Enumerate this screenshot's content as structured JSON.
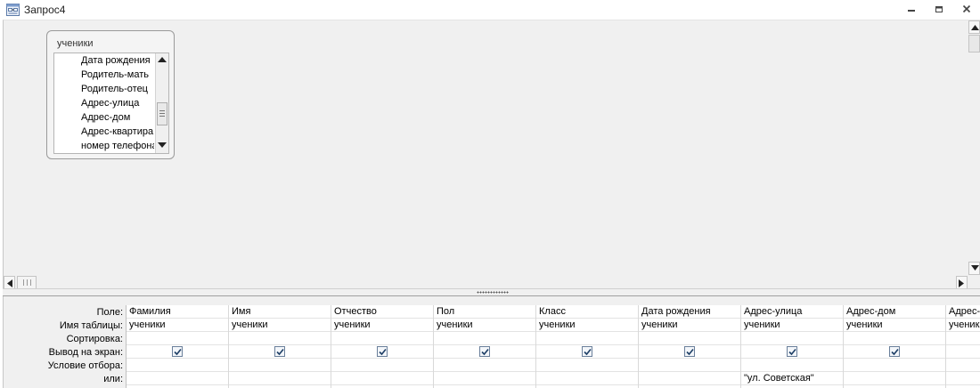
{
  "window": {
    "title": "Запрос4",
    "controls": {
      "minimize": "minimize-icon",
      "restore": "restore-icon",
      "close": "close-icon"
    }
  },
  "table": {
    "name": "ученики",
    "fields": [
      "Дата рождения",
      "Родитель-мать",
      "Родитель-отец",
      "Адрес-улица",
      "Адрес-дом",
      "Адрес-квартира",
      "номер телефона"
    ]
  },
  "grid": {
    "row_labels": [
      "Поле:",
      "Имя таблицы:",
      "Сортировка:",
      "Вывод на экран:",
      "Условие отбора:",
      "или:"
    ],
    "columns": [
      {
        "field": "Фамилия",
        "table": "ученики",
        "sort": "",
        "show": true,
        "criteria": "",
        "or": ""
      },
      {
        "field": "Имя",
        "table": "ученики",
        "sort": "",
        "show": true,
        "criteria": "",
        "or": ""
      },
      {
        "field": "Отчество",
        "table": "ученики",
        "sort": "",
        "show": true,
        "criteria": "",
        "or": ""
      },
      {
        "field": "Пол",
        "table": "ученики",
        "sort": "",
        "show": true,
        "criteria": "",
        "or": ""
      },
      {
        "field": "Класс",
        "table": "ученики",
        "sort": "",
        "show": true,
        "criteria": "",
        "or": ""
      },
      {
        "field": "Дата рождения",
        "table": "ученики",
        "sort": "",
        "show": true,
        "criteria": "",
        "or": ""
      },
      {
        "field": "Адрес-улица",
        "table": "ученики",
        "sort": "",
        "show": true,
        "criteria": "",
        "or": "\"ул. Советская\""
      },
      {
        "field": "Адрес-дом",
        "table": "ученики",
        "sort": "",
        "show": true,
        "criteria": "",
        "or": ""
      },
      {
        "field": "Адрес-квартира",
        "table": "ученики",
        "sort": "",
        "show": false,
        "criteria": "",
        "or": ""
      }
    ]
  },
  "colors": {
    "pane_bg": "#f0f0f0",
    "checkbox_border": "#6a7f9a",
    "checkmark": "#1e3f66"
  }
}
